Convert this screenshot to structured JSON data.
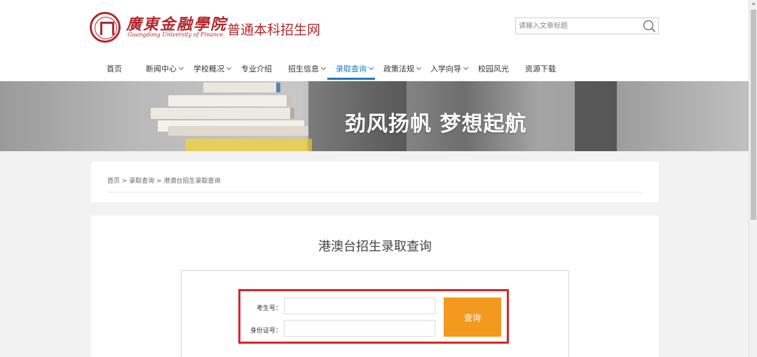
{
  "header": {
    "logo_cn": "廣東金融學院",
    "logo_en": "Guangdong University of Finance",
    "site_title": "普通本科招生网",
    "search": {
      "placeholder": "请输入文章标题",
      "icon": "search-icon"
    }
  },
  "nav": {
    "items": [
      {
        "label": "首页",
        "has_dropdown": false,
        "active": false
      },
      {
        "label": "新闻中心",
        "has_dropdown": true,
        "active": false
      },
      {
        "label": "学校概况",
        "has_dropdown": true,
        "active": false
      },
      {
        "label": "专业介绍",
        "has_dropdown": false,
        "active": false
      },
      {
        "label": "招生信息",
        "has_dropdown": true,
        "active": false
      },
      {
        "label": "录取查询",
        "has_dropdown": true,
        "active": true
      },
      {
        "label": "政策法规",
        "has_dropdown": true,
        "active": false
      },
      {
        "label": "入学向导",
        "has_dropdown": true,
        "active": false
      },
      {
        "label": "校园风光",
        "has_dropdown": false,
        "active": false
      },
      {
        "label": "资源下载",
        "has_dropdown": false,
        "active": false
      }
    ],
    "active_color": "#1e7bbd"
  },
  "banner": {
    "slogan": "劲风扬帆   梦想起航"
  },
  "breadcrumb": {
    "text": "首页 > 录取查询 > 港澳台招生录取查询"
  },
  "main": {
    "title": "港澳台招生录取查询",
    "form": {
      "exam_number_label": "考生号：",
      "exam_number_value": "",
      "id_number_label": "身份证号：",
      "id_number_value": "",
      "submit_label": "查询"
    }
  },
  "colors": {
    "brand_red": "#b3282d",
    "button_orange": "#f39a1e",
    "highlight_red": "#d9252b"
  }
}
